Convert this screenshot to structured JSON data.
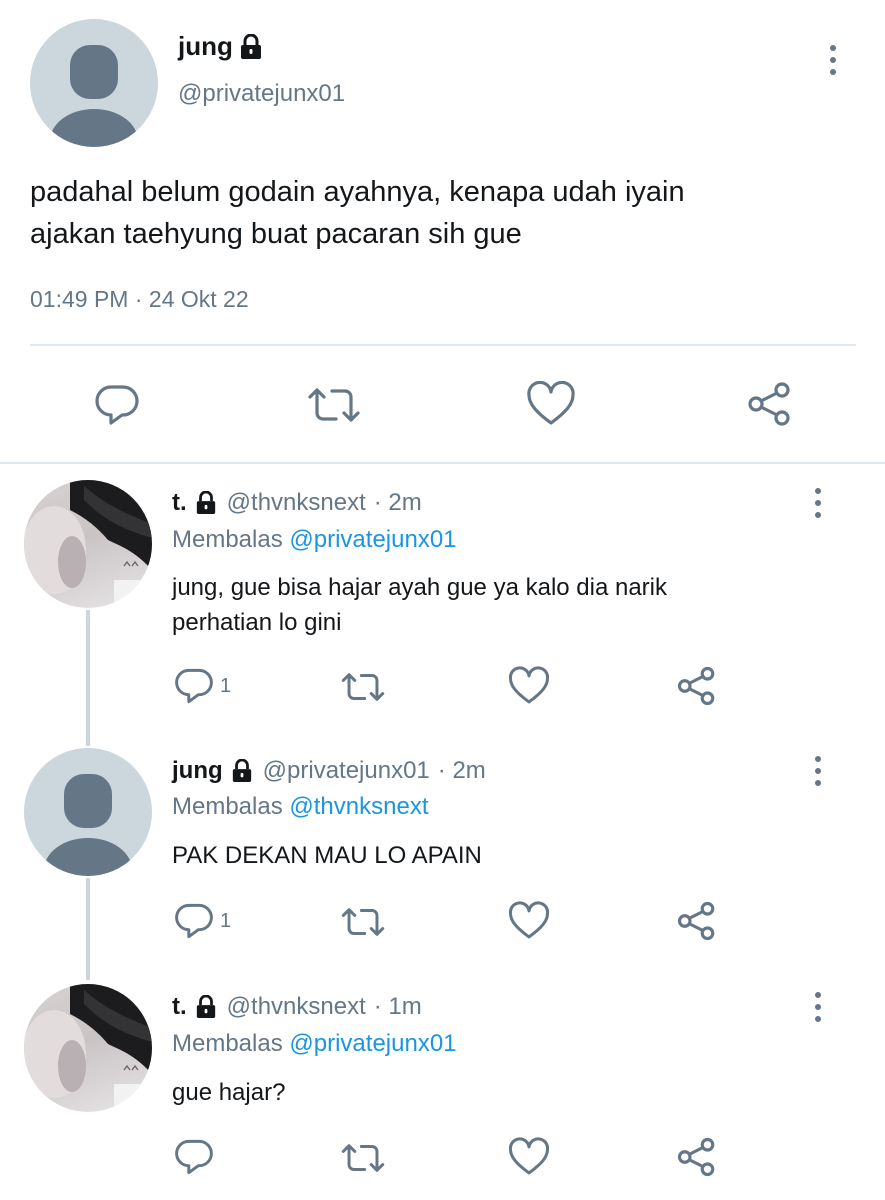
{
  "main_tweet": {
    "name": "jung",
    "handle": "@privatejunx01",
    "text_line1": "padahal belum godain ayahnya, kenapa udah iyain",
    "text_line2": "ajakan taehyung buat pacaran sih gue",
    "time": "01:49 PM",
    "separator": "·",
    "date": "24 Okt 22"
  },
  "replies": [
    {
      "name": "t.",
      "handle": "@thvnksnext",
      "time": "· 2m",
      "replying_prefix": "Membalas",
      "replying_to": "@privatejunx01",
      "text_line1": "jung, gue bisa hajar ayah gue ya kalo dia narik",
      "text_line2": "perhatian lo gini",
      "reply_count": "1"
    },
    {
      "name": "jung",
      "handle": "@privatejunx01",
      "time": "· 2m",
      "replying_prefix": "Membalas",
      "replying_to": "@thvnksnext",
      "text_line1": "PAK DEKAN MAU LO APAIN",
      "reply_count": "1"
    },
    {
      "name": "t.",
      "handle": "@thvnksnext",
      "time": "· 1m",
      "replying_prefix": "Membalas",
      "replying_to": "@privatejunx01",
      "text_line1": "gue hajar?"
    }
  ],
  "icons": {
    "reply": "reply-icon",
    "retweet": "retweet-icon",
    "like": "heart-icon",
    "share": "share-icon",
    "more": "more-vertical-icon",
    "lock": "lock-icon"
  },
  "colors": {
    "text": "#14171a",
    "secondary": "#657786",
    "link": "#1b95e0",
    "avatar_default": "#ccd6dd",
    "avatar_figure": "#657786",
    "divider": "#e1e8ed",
    "thread_line": "#ccd6dd"
  }
}
